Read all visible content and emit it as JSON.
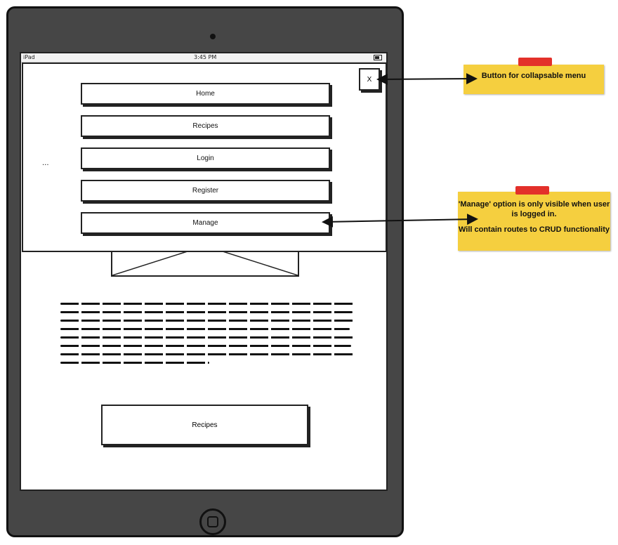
{
  "status_bar": {
    "carrier": "iPad",
    "time": "3:45 PM"
  },
  "menu": {
    "close_label": "X",
    "items": [
      {
        "label": "Home"
      },
      {
        "label": "Recipes"
      },
      {
        "label": "Login"
      },
      {
        "label": "Register"
      },
      {
        "label": "Manage"
      }
    ],
    "ellipsis": "..."
  },
  "page": {
    "recipes_button_label": "Recipes"
  },
  "annotations": {
    "note1": "Button for collapsable menu",
    "note2_line1": "'Manage' option is only visible when user is logged in.",
    "note2_line2": "Will contain routes to CRUD functionality"
  },
  "colors": {
    "note": "#f5cf3f",
    "tape": "#e3302a",
    "device": "#464646"
  }
}
